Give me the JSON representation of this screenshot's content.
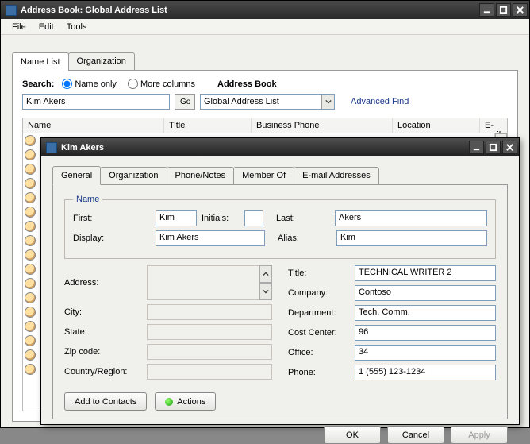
{
  "window": {
    "title": "Address Book: Global Address List",
    "menu": {
      "file": "File",
      "edit": "Edit",
      "tools": "Tools"
    },
    "tabs": {
      "name_list": "Name List",
      "organization": "Organization"
    },
    "search": {
      "label": "Search:",
      "name_only": "Name only",
      "more_columns": "More columns",
      "address_book_label": "Address Book",
      "value": "Kim Akers",
      "go": "Go",
      "address_book_value": "Global Address List",
      "advanced_find": "Advanced Find"
    },
    "columns": {
      "name": "Name",
      "title": "Title",
      "business_phone": "Business Phone",
      "location": "Location",
      "email": "E-mail"
    }
  },
  "dialog": {
    "title": "Kim Akers",
    "tabs": {
      "general": "General",
      "organization": "Organization",
      "phone_notes": "Phone/Notes",
      "member_of": "Member Of",
      "email": "E-mail Addresses"
    },
    "name_legend": "Name",
    "labels": {
      "first": "First:",
      "initials": "Initials:",
      "last": "Last:",
      "display": "Display:",
      "alias": "Alias:",
      "address": "Address:",
      "city": "City:",
      "state": "State:",
      "zip": "Zip code:",
      "country": "Country/Region:",
      "title": "Title:",
      "company": "Company:",
      "department": "Department:",
      "cost_center": "Cost Center:",
      "office": "Office:",
      "phone": "Phone:"
    },
    "values": {
      "first": "Kim",
      "initials": "",
      "last": "Akers",
      "display": "Kim Akers",
      "alias": "Kim",
      "address": "",
      "city": "",
      "state": "",
      "zip": "",
      "country": "",
      "title": "TECHNICAL WRITER 2",
      "company": "Contoso",
      "department": "Tech. Comm.",
      "cost_center": "96",
      "office": "34",
      "phone": "1 (555) 123-1234"
    },
    "buttons": {
      "add_to_contacts": "Add to Contacts",
      "actions": "Actions",
      "ok": "OK",
      "cancel": "Cancel",
      "apply": "Apply"
    }
  }
}
